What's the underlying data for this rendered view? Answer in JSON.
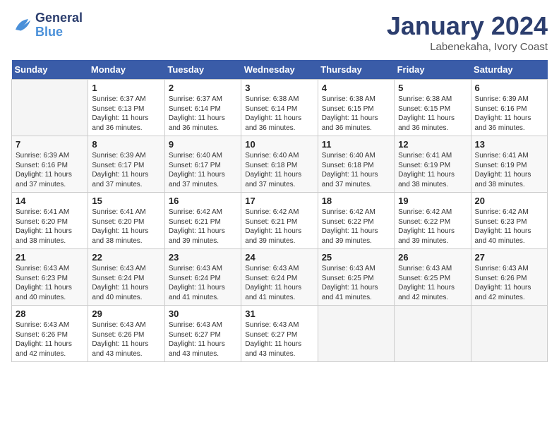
{
  "header": {
    "logo_line1": "General",
    "logo_line2": "Blue",
    "month": "January 2024",
    "location": "Labenekaha, Ivory Coast"
  },
  "days_of_week": [
    "Sunday",
    "Monday",
    "Tuesday",
    "Wednesday",
    "Thursday",
    "Friday",
    "Saturday"
  ],
  "weeks": [
    [
      {
        "day": "",
        "content": ""
      },
      {
        "day": "1",
        "content": "Sunrise: 6:37 AM\nSunset: 6:13 PM\nDaylight: 11 hours\nand 36 minutes."
      },
      {
        "day": "2",
        "content": "Sunrise: 6:37 AM\nSunset: 6:14 PM\nDaylight: 11 hours\nand 36 minutes."
      },
      {
        "day": "3",
        "content": "Sunrise: 6:38 AM\nSunset: 6:14 PM\nDaylight: 11 hours\nand 36 minutes."
      },
      {
        "day": "4",
        "content": "Sunrise: 6:38 AM\nSunset: 6:15 PM\nDaylight: 11 hours\nand 36 minutes."
      },
      {
        "day": "5",
        "content": "Sunrise: 6:38 AM\nSunset: 6:15 PM\nDaylight: 11 hours\nand 36 minutes."
      },
      {
        "day": "6",
        "content": "Sunrise: 6:39 AM\nSunset: 6:16 PM\nDaylight: 11 hours\nand 36 minutes."
      }
    ],
    [
      {
        "day": "7",
        "content": "Sunrise: 6:39 AM\nSunset: 6:16 PM\nDaylight: 11 hours\nand 37 minutes."
      },
      {
        "day": "8",
        "content": "Sunrise: 6:39 AM\nSunset: 6:17 PM\nDaylight: 11 hours\nand 37 minutes."
      },
      {
        "day": "9",
        "content": "Sunrise: 6:40 AM\nSunset: 6:17 PM\nDaylight: 11 hours\nand 37 minutes."
      },
      {
        "day": "10",
        "content": "Sunrise: 6:40 AM\nSunset: 6:18 PM\nDaylight: 11 hours\nand 37 minutes."
      },
      {
        "day": "11",
        "content": "Sunrise: 6:40 AM\nSunset: 6:18 PM\nDaylight: 11 hours\nand 37 minutes."
      },
      {
        "day": "12",
        "content": "Sunrise: 6:41 AM\nSunset: 6:19 PM\nDaylight: 11 hours\nand 38 minutes."
      },
      {
        "day": "13",
        "content": "Sunrise: 6:41 AM\nSunset: 6:19 PM\nDaylight: 11 hours\nand 38 minutes."
      }
    ],
    [
      {
        "day": "14",
        "content": "Sunrise: 6:41 AM\nSunset: 6:20 PM\nDaylight: 11 hours\nand 38 minutes."
      },
      {
        "day": "15",
        "content": "Sunrise: 6:41 AM\nSunset: 6:20 PM\nDaylight: 11 hours\nand 38 minutes."
      },
      {
        "day": "16",
        "content": "Sunrise: 6:42 AM\nSunset: 6:21 PM\nDaylight: 11 hours\nand 39 minutes."
      },
      {
        "day": "17",
        "content": "Sunrise: 6:42 AM\nSunset: 6:21 PM\nDaylight: 11 hours\nand 39 minutes."
      },
      {
        "day": "18",
        "content": "Sunrise: 6:42 AM\nSunset: 6:22 PM\nDaylight: 11 hours\nand 39 minutes."
      },
      {
        "day": "19",
        "content": "Sunrise: 6:42 AM\nSunset: 6:22 PM\nDaylight: 11 hours\nand 39 minutes."
      },
      {
        "day": "20",
        "content": "Sunrise: 6:42 AM\nSunset: 6:23 PM\nDaylight: 11 hours\nand 40 minutes."
      }
    ],
    [
      {
        "day": "21",
        "content": "Sunrise: 6:43 AM\nSunset: 6:23 PM\nDaylight: 11 hours\nand 40 minutes."
      },
      {
        "day": "22",
        "content": "Sunrise: 6:43 AM\nSunset: 6:24 PM\nDaylight: 11 hours\nand 40 minutes."
      },
      {
        "day": "23",
        "content": "Sunrise: 6:43 AM\nSunset: 6:24 PM\nDaylight: 11 hours\nand 41 minutes."
      },
      {
        "day": "24",
        "content": "Sunrise: 6:43 AM\nSunset: 6:24 PM\nDaylight: 11 hours\nand 41 minutes."
      },
      {
        "day": "25",
        "content": "Sunrise: 6:43 AM\nSunset: 6:25 PM\nDaylight: 11 hours\nand 41 minutes."
      },
      {
        "day": "26",
        "content": "Sunrise: 6:43 AM\nSunset: 6:25 PM\nDaylight: 11 hours\nand 42 minutes."
      },
      {
        "day": "27",
        "content": "Sunrise: 6:43 AM\nSunset: 6:26 PM\nDaylight: 11 hours\nand 42 minutes."
      }
    ],
    [
      {
        "day": "28",
        "content": "Sunrise: 6:43 AM\nSunset: 6:26 PM\nDaylight: 11 hours\nand 42 minutes."
      },
      {
        "day": "29",
        "content": "Sunrise: 6:43 AM\nSunset: 6:26 PM\nDaylight: 11 hours\nand 43 minutes."
      },
      {
        "day": "30",
        "content": "Sunrise: 6:43 AM\nSunset: 6:27 PM\nDaylight: 11 hours\nand 43 minutes."
      },
      {
        "day": "31",
        "content": "Sunrise: 6:43 AM\nSunset: 6:27 PM\nDaylight: 11 hours\nand 43 minutes."
      },
      {
        "day": "",
        "content": ""
      },
      {
        "day": "",
        "content": ""
      },
      {
        "day": "",
        "content": ""
      }
    ]
  ]
}
